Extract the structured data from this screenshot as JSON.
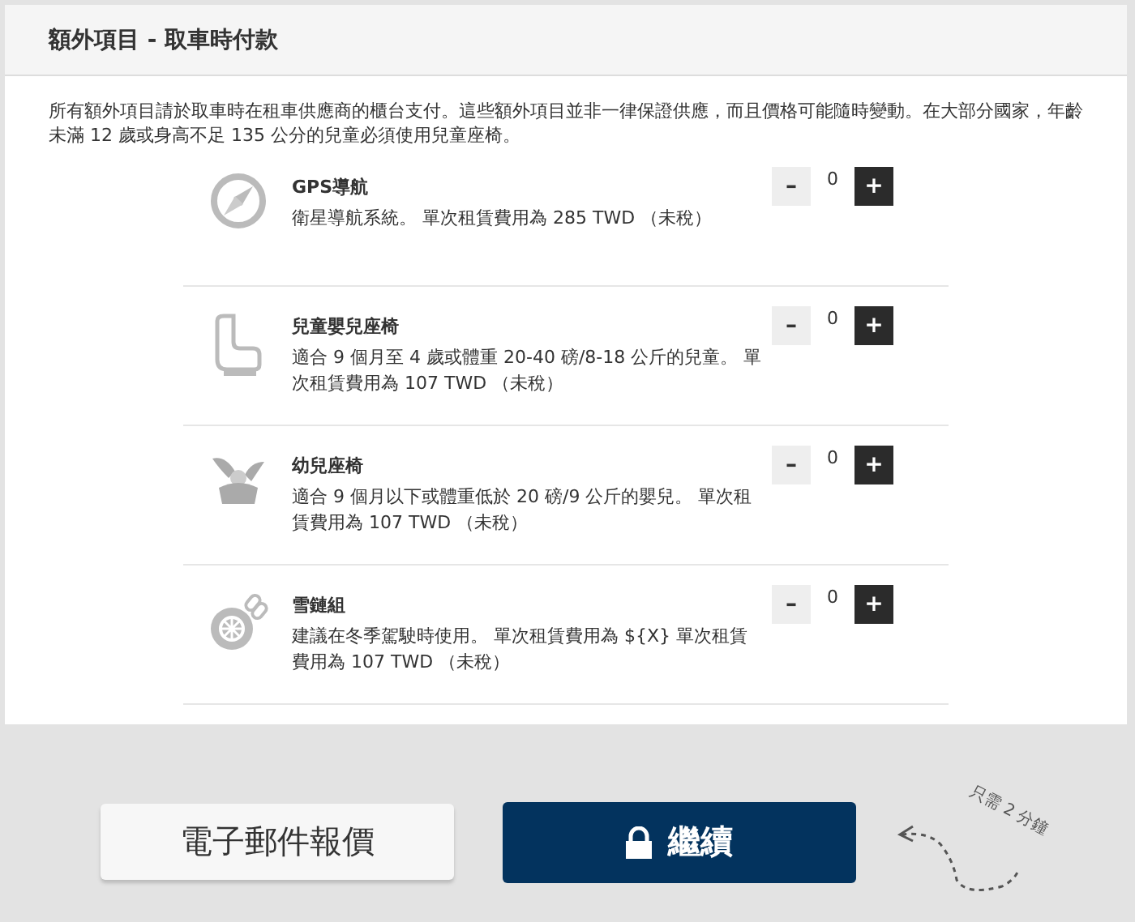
{
  "panel": {
    "title": "額外項目 - 取車時付款",
    "intro": "所有額外項目請於取車時在租車供應商的櫃台支付。這些額外項目並非一律保證供應，而且價格可能隨時變動。在大部分國家，年齡未滿 12 歲或身高不足 135 公分的兒童必須使用兒童座椅。"
  },
  "extras": [
    {
      "kind": "gps",
      "name": "GPS導航",
      "description": "衛星導航系統。 單次租賃費用為 285 TWD （未稅）",
      "minus": "–",
      "count": "0",
      "plus": "+"
    },
    {
      "kind": "child-seat",
      "name": "兒童嬰兒座椅",
      "description": "適合 9 個月至 4 歲或體重 20-40 磅/8-18 公斤的兒童。 單次租賃費用為 107 TWD （未稅）",
      "minus": "–",
      "count": "0",
      "plus": "+"
    },
    {
      "kind": "infant-seat",
      "name": "幼兒座椅",
      "description": "適合 9 個月以下或體重低於 20 磅/9 公斤的嬰兒。 單次租賃費用為 107 TWD （未稅）",
      "minus": "–",
      "count": "0",
      "plus": "+"
    },
    {
      "kind": "snow-chains",
      "name": "雪鏈組",
      "description": "建議在冬季駕駛時使用。 單次租賃費用為 ${X} 單次租賃費用為 107 TWD （未稅）",
      "minus": "–",
      "count": "0",
      "plus": "+"
    }
  ],
  "actions": {
    "email_quote": "電子郵件報價",
    "continue": "繼續",
    "note": "只需 2 分鐘"
  }
}
